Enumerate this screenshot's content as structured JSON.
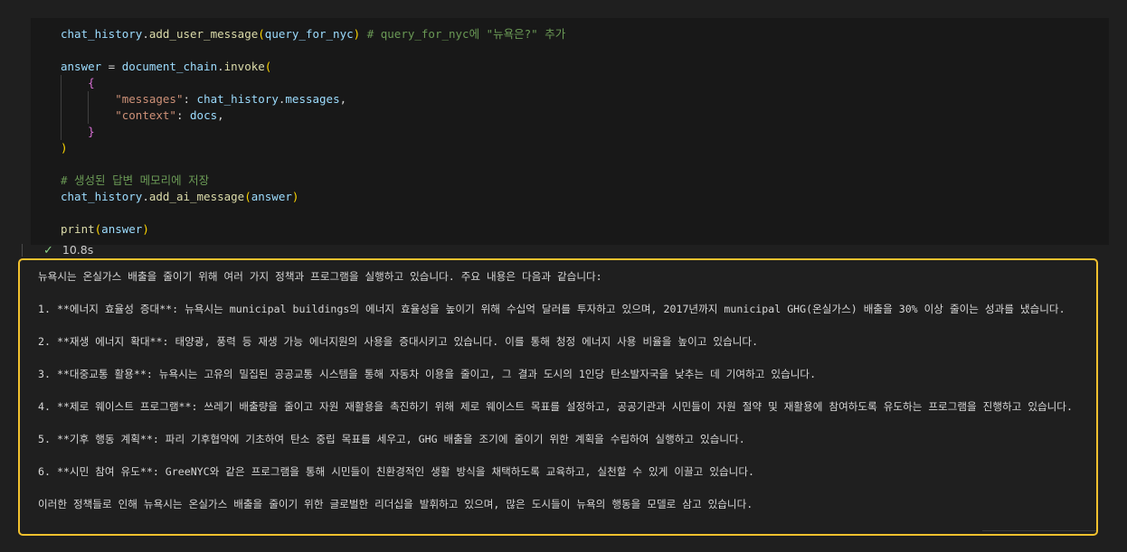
{
  "code": {
    "line1": {
      "obj": "chat_history",
      "method": "add_user_message",
      "arg": "query_for_nyc",
      "comment": "# query_for_nyc에 \"뉴욕은?\" 추가"
    },
    "line2": {
      "var": "answer",
      "obj": "document_chain",
      "method": "invoke"
    },
    "line4": {
      "key": "\"messages\"",
      "obj": "chat_history",
      "attr": "messages"
    },
    "line5": {
      "key": "\"context\"",
      "val": "docs"
    },
    "line8": {
      "comment": "# 생성된 답변 메모리에 저장"
    },
    "line9": {
      "obj": "chat_history",
      "method": "add_ai_message",
      "arg": "answer"
    },
    "line10": {
      "fn": "print",
      "arg": "answer"
    }
  },
  "status": {
    "check_icon": "checkmark-icon",
    "duration": "10.8s",
    "success_color": "#89d185"
  },
  "output": {
    "border_color": "#f2c12e",
    "lines": [
      "뉴욕시는 온실가스 배출을 줄이기 위해 여러 가지 정책과 프로그램을 실행하고 있습니다. 주요 내용은 다음과 같습니다:",
      "1. **에너지 효율성 증대**: 뉴욕시는 municipal buildings의 에너지 효율성을 높이기 위해 수십억 달러를 투자하고 있으며, 2017년까지 municipal GHG(온실가스) 배출을 30% 이상 줄이는 성과를 냈습니다.",
      "2. **재생 에너지 확대**: 태양광, 풍력 등 재생 가능 에너지원의 사용을 증대시키고 있습니다. 이를 통해 청정 에너지 사용 비율을 높이고 있습니다.",
      "3. **대중교통 활용**: 뉴욕시는 고유의 밀집된 공공교통 시스템을 통해 자동차 이용을 줄이고, 그 결과 도시의 1인당 탄소발자국을 낮추는 데 기여하고 있습니다.",
      "4. **제로 웨이스트 프로그램**: 쓰레기 배출량을 줄이고 자원 재활용을 촉진하기 위해 제로 웨이스트 목표를 설정하고, 공공기관과 시민들이 자원 절약 및 재활용에 참여하도록 유도하는 프로그램을 진행하고 있습니다.",
      "5. **기후 행동 계획**: 파리 기후협약에 기초하여 탄소 중립 목표를 세우고, GHG 배출을 조기에 줄이기 위한 계획을 수립하여 실행하고 있습니다.",
      "6. **시민 참여 유도**: GreeNYC와 같은 프로그램을 통해 시민들이 친환경적인 생활 방식을 채택하도록 교육하고, 실천할 수 있게 이끌고 있습니다.",
      "이러한 정책들로 인해 뉴욕시는 온실가스 배출을 줄이기 위한 글로벌한 리더십을 발휘하고 있으며, 많은 도시들이 뉴욕의 행동을 모델로 삼고 있습니다."
    ]
  }
}
